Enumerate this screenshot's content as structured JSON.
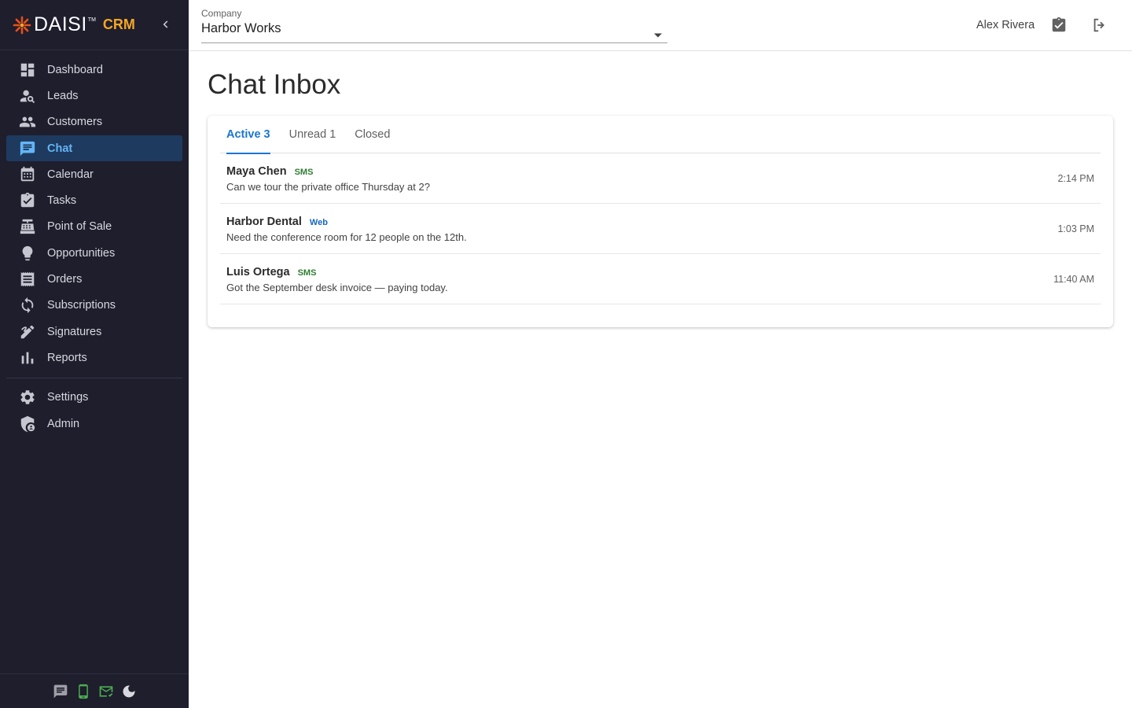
{
  "brand": {
    "name": "DAISI",
    "tm": "TM",
    "product": "CRM"
  },
  "sidebar": {
    "items": [
      {
        "label": "Dashboard",
        "icon": "dashboard-icon",
        "active": false
      },
      {
        "label": "Leads",
        "icon": "person-search-icon",
        "active": false
      },
      {
        "label": "Customers",
        "icon": "people-icon",
        "active": false
      },
      {
        "label": "Chat",
        "icon": "chat-icon",
        "active": true
      },
      {
        "label": "Calendar",
        "icon": "calendar-icon",
        "active": false
      },
      {
        "label": "Tasks",
        "icon": "clipboard-check-icon",
        "active": false
      },
      {
        "label": "Point of Sale",
        "icon": "cash-register-icon",
        "active": false
      },
      {
        "label": "Opportunities",
        "icon": "lightbulb-icon",
        "active": false
      },
      {
        "label": "Orders",
        "icon": "receipt-icon",
        "active": false
      },
      {
        "label": "Subscriptions",
        "icon": "refresh-icon",
        "active": false
      },
      {
        "label": "Signatures",
        "icon": "signature-icon",
        "active": false
      },
      {
        "label": "Reports",
        "icon": "bar-chart-icon",
        "active": false
      }
    ],
    "secondary_items": [
      {
        "label": "Settings",
        "icon": "gear-icon"
      },
      {
        "label": "Admin",
        "icon": "admin-shield-icon"
      }
    ],
    "footer_icons": [
      "message-icon",
      "phone-icon",
      "mail-check-icon",
      "moon-icon"
    ]
  },
  "topbar": {
    "company_label": "Company",
    "company_value": "Harbor Works",
    "user_name": "Alex Rivera",
    "icons": [
      "clipboard-check-icon",
      "logout-icon"
    ]
  },
  "main": {
    "title": "Chat Inbox",
    "tabs": [
      {
        "label": "Active 3",
        "active": true
      },
      {
        "label": "Unread 1",
        "active": false
      },
      {
        "label": "Closed",
        "active": false
      }
    ],
    "conversations": [
      {
        "name": "Maya Chen",
        "channel": "SMS",
        "preview": "Can we tour the private office Thursday at 2?",
        "time": "2:14 PM"
      },
      {
        "name": "Harbor Dental",
        "channel": "Web",
        "preview": "Need the conference room for 12 people on the 12th.",
        "time": "1:03 PM"
      },
      {
        "name": "Luis Ortega",
        "channel": "SMS",
        "preview": "Got the September desk invoice — paying today.",
        "time": "11:40 AM"
      }
    ]
  },
  "colors": {
    "sidebar_bg": "#1e1e2d",
    "active_bg": "#1e3a5f",
    "active_text": "#64b5f6",
    "accent": "#1976d2",
    "brand_orange": "#f5a623",
    "sms": "#2e7d32",
    "web": "#1565c0"
  }
}
